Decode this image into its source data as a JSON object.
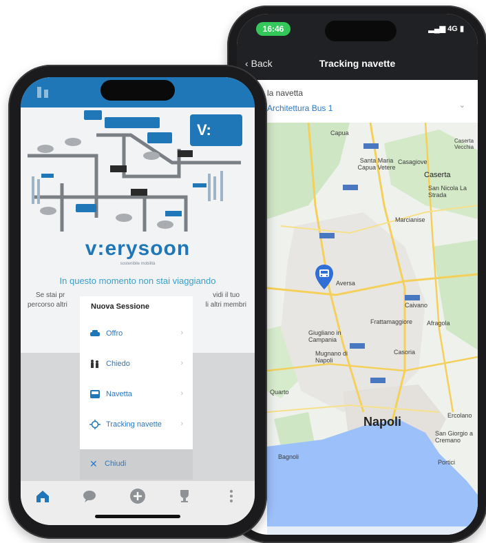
{
  "right_phone": {
    "status": {
      "time": "16:46",
      "network": "4G"
    },
    "nav": {
      "back_label": "Back",
      "title": "Tracking navette"
    },
    "selector": {
      "label": "la navetta",
      "value": "Architettura Bus 1"
    },
    "map": {
      "places": {
        "capua": "Capua",
        "caserta": "Caserta",
        "caserta_vecchia": "Caserta Vecchia",
        "santa_maria": "Santa Maria Capua Vetere",
        "casagiove": "Casagiove",
        "san_nicola": "San Nicola La Strada",
        "marcianise": "Marcianise",
        "aversa": "Aversa",
        "caivano": "Caivano",
        "frattamaggiore": "Frattamaggiore",
        "afragola": "Afragola",
        "giugliano": "Giugliano in Campania",
        "mugnano": "Mugnano di Napoli",
        "casoria": "Casoria",
        "quarto": "Quarto",
        "napoli": "Napoli",
        "bagnoli": "Bagnoli",
        "ercolano": "Ercolano",
        "san_giorgio": "San Giorgio a Cremano",
        "portici": "Portici"
      }
    }
  },
  "left_phone": {
    "brand": "v:erysoon",
    "brand_sub": "sostenibile mobilità",
    "badge": "V:",
    "status_message": "In questo momento non stai viaggiando",
    "description_left_1": "Se stai pr",
    "description_right_1": "vidi il tuo",
    "description_left_2": "percorso altri",
    "description_right_2": "li altri membri",
    "menu": {
      "title": "Nuova Sessione",
      "items": [
        {
          "label": "Offro",
          "icon": "car-icon"
        },
        {
          "label": "Chiedo",
          "icon": "people-icon"
        },
        {
          "label": "Navetta",
          "icon": "bus-icon"
        },
        {
          "label": "Tracking navette",
          "icon": "tracking-icon"
        }
      ],
      "close_label": "Chiudi"
    },
    "tabs": [
      "home-icon",
      "chat-icon",
      "add-icon",
      "trophy-icon",
      "more-icon"
    ]
  },
  "colors": {
    "brand_blue": "#2077b7",
    "link_blue": "#2b78c5",
    "status_green": "#34c759",
    "map_pin": "#2f6fd6"
  }
}
